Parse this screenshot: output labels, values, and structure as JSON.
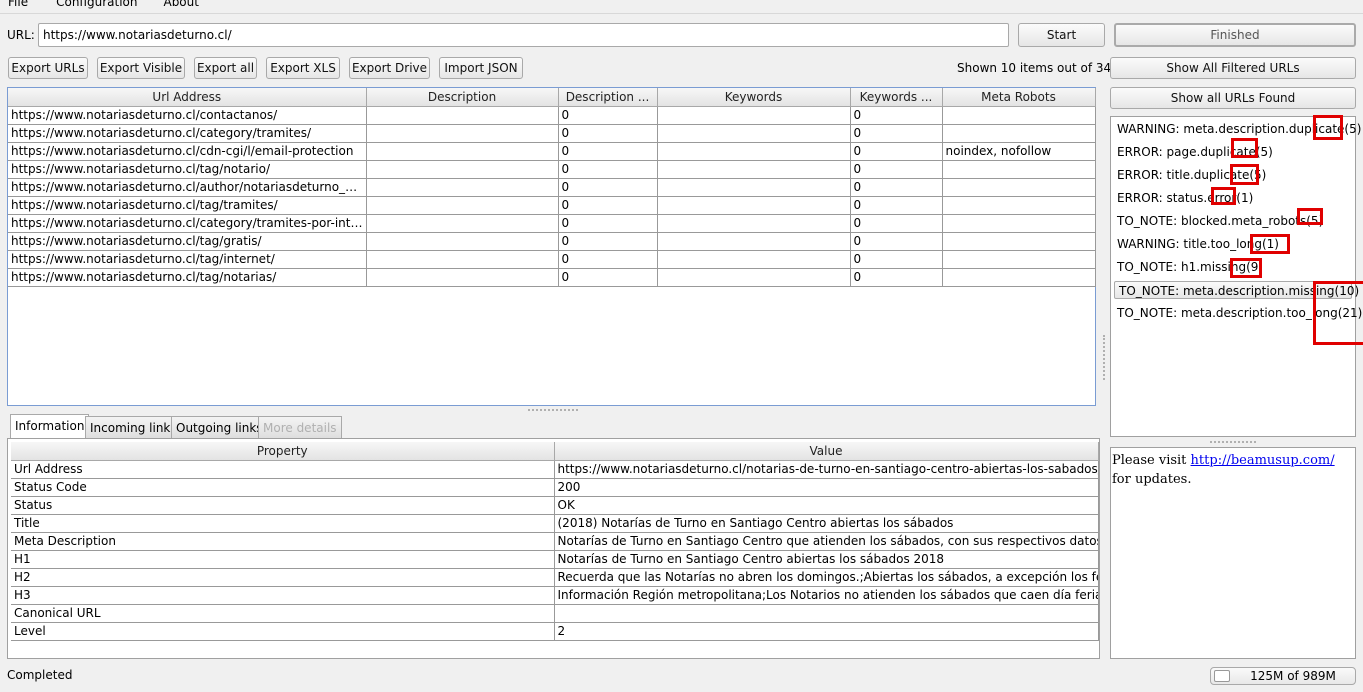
{
  "menu": [
    "File",
    "Configuration",
    "About"
  ],
  "url_bar": {
    "label": "URL:",
    "value": "https://www.notariasdeturno.cl/"
  },
  "start_button": "Start",
  "status_button": "Finished",
  "toolbar": [
    "Export URLs",
    "Export Visible",
    "Export all",
    "Export XLS",
    "Export Drive",
    "Import JSON"
  ],
  "shown_count": "Shown 10 items out of 34",
  "side_buttons": {
    "show_filtered": "Show All Filtered URLs",
    "show_all": "Show all URLs Found"
  },
  "results_table": {
    "columns": [
      "Url Address",
      "Description",
      "Description ...",
      "Keywords",
      "Keywords ...",
      "Meta Robots"
    ],
    "rows": [
      [
        "https://www.notariasdeturno.cl/contactanos/",
        "",
        "0",
        "",
        "0",
        ""
      ],
      [
        "https://www.notariasdeturno.cl/category/tramites/",
        "",
        "0",
        "",
        "0",
        ""
      ],
      [
        "https://www.notariasdeturno.cl/cdn-cgi/l/email-protection",
        "",
        "0",
        "",
        "0",
        "noindex, nofollow"
      ],
      [
        "https://www.notariasdeturno.cl/tag/notario/",
        "",
        "0",
        "",
        "0",
        ""
      ],
      [
        "https://www.notariasdeturno.cl/author/notariasdeturno_oxak...",
        "",
        "0",
        "",
        "0",
        ""
      ],
      [
        "https://www.notariasdeturno.cl/tag/tramites/",
        "",
        "0",
        "",
        "0",
        ""
      ],
      [
        "https://www.notariasdeturno.cl/category/tramites-por-internet/",
        "",
        "0",
        "",
        "0",
        ""
      ],
      [
        "https://www.notariasdeturno.cl/tag/gratis/",
        "",
        "0",
        "",
        "0",
        ""
      ],
      [
        "https://www.notariasdeturno.cl/tag/internet/",
        "",
        "0",
        "",
        "0",
        ""
      ],
      [
        "https://www.notariasdeturno.cl/tag/notarias/",
        "",
        "0",
        "",
        "0",
        ""
      ]
    ]
  },
  "issues": [
    {
      "text": "WARNING: meta.description.duplicate(5)",
      "selected": false
    },
    {
      "text": "ERROR: page.duplicate(5)",
      "selected": false
    },
    {
      "text": "ERROR: title.duplicate(5)",
      "selected": false
    },
    {
      "text": "ERROR: status.error(1)",
      "selected": false
    },
    {
      "text": "TO_NOTE: blocked.meta_robots(5)",
      "selected": false
    },
    {
      "text": "WARNING: title.too_long(1)",
      "selected": false
    },
    {
      "text": "TO_NOTE: h1.missing(9)",
      "selected": false
    },
    {
      "text": "TO_NOTE: meta.description.missing(10)",
      "selected": true
    },
    {
      "text": "TO_NOTE: meta.description.too_long(21)",
      "selected": false
    }
  ],
  "detail_tabs": [
    {
      "label": "Information",
      "active": true,
      "enabled": true
    },
    {
      "label": "Incoming links",
      "active": false,
      "enabled": true
    },
    {
      "label": "Outgoing links",
      "active": false,
      "enabled": true
    },
    {
      "label": "More details",
      "active": false,
      "enabled": false
    }
  ],
  "info_table": {
    "columns": [
      "Property",
      "Value"
    ],
    "rows": [
      [
        "Url Address",
        "https://www.notariasdeturno.cl/notarias-de-turno-en-santiago-centro-abiertas-los-sabados/?repl..."
      ],
      [
        "Status Code",
        "200"
      ],
      [
        "Status",
        "OK"
      ],
      [
        "Title",
        "(2018) Notarías de Turno en Santiago Centro abiertas los sábados"
      ],
      [
        "Meta Description",
        "Notarías de Turno en Santiago Centro que atienden los sábados, con sus respectivos datos: nú..."
      ],
      [
        "H1",
        "Notarías de Turno en Santiago Centro abiertas los sábados 2018"
      ],
      [
        "H2",
        "Recuerda que las Notarías no abren los domingos.;Abiertas los sábados, a excepción los feriados...."
      ],
      [
        "H3",
        "Información Región metropolitana;Los Notarios no atienden los sábados que caen día feriado.;H..."
      ],
      [
        "Canonical URL",
        ""
      ],
      [
        "Level",
        "2"
      ]
    ]
  },
  "notice": {
    "prefix": "Please visit ",
    "link": "http://beamusup.com/",
    "suffix": " for updates."
  },
  "status_bar": {
    "text": "Completed",
    "memory": "125M of 989M"
  },
  "colors": {
    "annotation_red": "#e00000",
    "link": "#0000ee"
  }
}
